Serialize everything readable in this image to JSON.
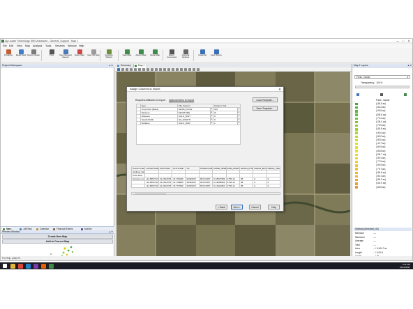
{
  "window": {
    "title": "Ag Leader Technology SMS Advanced - General_Support - Map 1",
    "minimize": "—",
    "maximize": "□",
    "close": "✕"
  },
  "menu": [
    "File",
    "Edit",
    "View",
    "Map",
    "Analysis",
    "Tools",
    "Services",
    "Window",
    "Help"
  ],
  "toolbar": [
    {
      "label": "Products",
      "icon": "products-icon",
      "color": "#c25f32"
    },
    {
      "label": "Read Field",
      "icon": "read-field-icon",
      "color": "#3f7cc9"
    },
    {
      "label": "Device Setup",
      "icon": "device-setup-icon",
      "color": "#7a7a7a"
    },
    {
      "label": "Print",
      "icon": "print-icon",
      "color": "#555555"
    },
    {
      "label": "New General Report",
      "icon": "general-report-icon",
      "color": "#4a78b5"
    },
    {
      "label": "New Chart",
      "icon": "chart-icon",
      "color": "#c84a4a"
    },
    {
      "label": "New 3D Map",
      "icon": "3d-map-icon",
      "color": "#9a9a9a"
    },
    {
      "label": "Analysis Wizard",
      "icon": "analysis-wizard-icon",
      "color": "#6b8f3a"
    },
    {
      "label": "New Map",
      "icon": "new-map-icon",
      "color": "#3f8b4a"
    },
    {
      "label": "Add to Map",
      "icon": "add-to-map-icon",
      "color": "#3f8b4a"
    },
    {
      "label": "Close Map",
      "icon": "close-map-icon",
      "color": "#3f8b4a"
    },
    {
      "label": "Batch Command",
      "icon": "batch-command-icon",
      "color": "#555555"
    },
    {
      "label": "General Options",
      "icon": "general-options-icon",
      "color": "#666666"
    },
    {
      "label": "Close All",
      "icon": "close-all-icon",
      "color": "#3b6fb5"
    },
    {
      "label": "Help Topics",
      "icon": "help-topics-icon",
      "color": "#3b6fb5"
    }
  ],
  "left_panel": {
    "title": "Project Workspace",
    "tabs": [
      {
        "label": "Main",
        "color": "#3b7d3b"
      },
      {
        "label": "Job/Task",
        "color": "#4a78b5"
      },
      {
        "label": "Calendar",
        "color": "#c58a2f"
      },
      {
        "label": "Financial Entries",
        "color": "#8a5a2f"
      },
      {
        "label": "Monitor",
        "color": "#4a4a8a"
      }
    ],
    "preview_title": "Preview Window",
    "create_new_map": "Create New Map",
    "add_to_current_map": "Add to Current Map",
    "scale_left": "0",
    "scale_right": "3600ft"
  },
  "map": {
    "tabs": [
      {
        "label": "Summary",
        "icon": "summary-icon"
      },
      {
        "label": "Map 1",
        "icon": "map-icon"
      }
    ],
    "bottom_tabs": [
      "Map Summary",
      "Query Results",
      "Picture Notes"
    ]
  },
  "right_panel": {
    "title": "Map 1 Layers",
    "layer_select": "Field - Name",
    "transparency": "Transparency - 100 %",
    "legend_title": "Field - Name",
    "legend": [
      {
        "label": "(118.8 ac)",
        "color": "#3fa83f"
      },
      {
        "label": "( 80.3 ac)",
        "color": "#4bb03c"
      },
      {
        "label": "( 99.5 ac)",
        "color": "#58b739"
      },
      {
        "label": "(204.8 ac)",
        "color": "#66bd36"
      },
      {
        "label": "( 72.4 ac)",
        "color": "#74c233"
      },
      {
        "label": "(134.0 ac)",
        "color": "#83c731"
      },
      {
        "label": "( 79.9 ac)",
        "color": "#92cc2f"
      },
      {
        "label": "(118.8 ac)",
        "color": "#a1d12d"
      },
      {
        "label": "( 80.0 ac)",
        "color": "#b0d52b"
      },
      {
        "label": "( 80.0 ac)",
        "color": "#bed92a"
      },
      {
        "label": "( 80.0 ac)",
        "color": "#ccdd29"
      },
      {
        "label": "( 41.7 ac)",
        "color": "#d8e028"
      },
      {
        "label": "( 80.5 ac)",
        "color": "#e2e228"
      },
      {
        "label": "( 80.8 ac)",
        "color": "#e8e029"
      },
      {
        "label": "(134.7 ac)",
        "color": "#ecdb2a"
      },
      {
        "label": "( 80.4 ac)",
        "color": "#eed52b"
      },
      {
        "label": "( 77.5 ac)",
        "color": "#efcf2c"
      },
      {
        "label": "( 80.5 ac)",
        "color": "#efc82d"
      },
      {
        "label": "( 79.7 ac)",
        "color": "#efc02e"
      },
      {
        "label": "(118.6 ac)",
        "color": "#eeb82f"
      },
      {
        "label": "( 80.1 ac)",
        "color": "#edb030"
      },
      {
        "label": "(119.3 ac)",
        "color": "#eba831"
      },
      {
        "label": "(101.9 ac)",
        "color": "#e9a032"
      },
      {
        "label": "( 80.5 ac)",
        "color": "#e79833"
      }
    ],
    "stats_title": "Statistics(Selected) (40)",
    "stats": [
      {
        "label": "Minimum",
        "value": "----"
      },
      {
        "label": "Maximum",
        "value": "----"
      },
      {
        "label": "Average",
        "value": "----"
      },
      {
        "label": "Total",
        "value": "----"
      },
      {
        "label": "Area",
        "value": "-- / 3,404.7 ac"
      },
      {
        "label": "Length",
        "value": "-- / 0.00 ft"
      },
      {
        "label": "Count",
        "value": "-- / 32"
      }
    ]
  },
  "dialog": {
    "title": "Assign Columns to Import",
    "close": "✕",
    "required_label": "Required Attributes to Import",
    "optional_label": "Optional Items to Import",
    "load_template": "Load Template...",
    "save_template": "Save Template...",
    "mapping_headers": [
      "Item",
      "File Column",
      "Column Unit"
    ],
    "mapping_rows": [
      [
        "Crop Flow (Mass)",
        "MASS_FLOW",
        "lb/s"
      ],
      [
        "Moisture",
        "MOISTURE",
        "%"
      ],
      [
        "Distance",
        "CALC_DIST",
        "ft"
      ],
      [
        "Swath Width",
        "SG_SWATH",
        "ft"
      ],
      [
        "Duration",
        "CALC_DUR",
        "s"
      ]
    ],
    "preview_headers": [
      "Column Name",
      "LONGITUDE",
      "LATITUDE",
      "ALTITUDE",
      "TS",
      "TRUECOURSE",
      "GRND_SPEED",
      "DPM_PHED",
      "GRAIN_PHED",
      "GRAIN_MOIS",
      "GRAIN_TEMP"
    ],
    "preview_label_rows": [
      "Attribute Name",
      "Units Row"
    ],
    "preview_rows": [
      [
        "Sample row",
        "-94.8352713",
        "41.2613378",
        "417.58189",
        "9/28/2017",
        "353.16367",
        "0.18547989",
        "1756.12",
        "88",
        "0",
        "0"
      ],
      [
        "",
        "-94.8353711",
        "41.2613378",
        "417.58889",
        "9/28/2017",
        "353.16367",
        "0.19658962",
        "1756.12",
        "88",
        "0",
        "0"
      ],
      [
        "",
        "-94.8352711",
        "41.2613378",
        "417.57999",
        "9/28/2017",
        "353.16367",
        "0.13421864",
        "1756.12",
        "88",
        "0",
        "0"
      ]
    ],
    "back": "< Back",
    "next": "Next >",
    "cancel": "Cancel",
    "help": "Help"
  },
  "status_bar": "For Help, press F1",
  "taskbar": {
    "time": "4:31 PM",
    "date": "10/13/2017",
    "icons": [
      {
        "name": "windows-start-icon",
        "color": "#ffffff"
      },
      {
        "name": "file-explorer-icon",
        "color": "#e4b53c"
      },
      {
        "name": "chrome-icon",
        "color": "#db4437"
      },
      {
        "name": "media-player-icon",
        "color": "#1f82c9"
      },
      {
        "name": "onenote-icon",
        "color": "#7b3aa6"
      },
      {
        "name": "firefox-icon",
        "color": "#e66000"
      },
      {
        "name": "ag-leader-icon",
        "color": "#3f8b4a"
      }
    ]
  }
}
